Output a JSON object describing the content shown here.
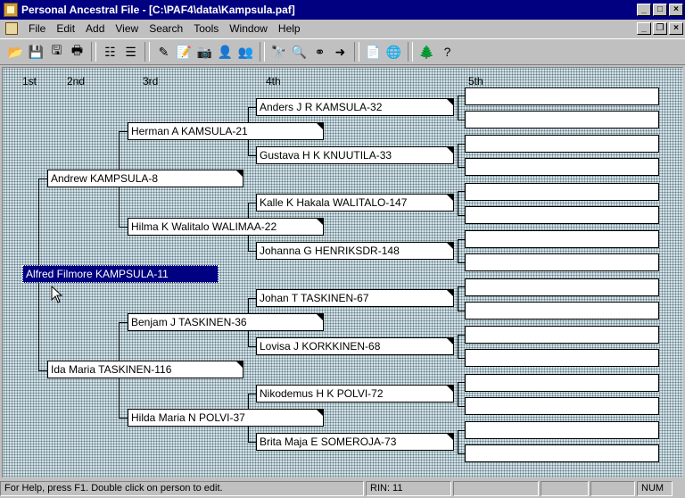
{
  "window": {
    "title": "Personal Ancestral File - [C:\\PAF4\\data\\Kampsula.paf]",
    "controls": [
      "minimize",
      "maximize",
      "close"
    ]
  },
  "menu": [
    {
      "label": "File"
    },
    {
      "label": "Edit"
    },
    {
      "label": "Add"
    },
    {
      "label": "View"
    },
    {
      "label": "Search"
    },
    {
      "label": "Tools"
    },
    {
      "label": "Window"
    },
    {
      "label": "Help"
    }
  ],
  "toolbar": {
    "icons": [
      "open-folder-icon",
      "save-icon",
      "save-as-icon",
      "print-icon",
      "family-view-icon",
      "pedigree-view-icon",
      "edit-individual-icon",
      "notes-icon",
      "multimedia-icon",
      "add-person-icon",
      "add-family-icon",
      "search-icon",
      "search-individual-icon",
      "relationship-icon",
      "navigate-icon",
      "reports-icon",
      "internet-icon",
      "tree-icon",
      "help-icon"
    ]
  },
  "pedigree": {
    "generations": [
      "1st",
      "2nd",
      "3rd",
      "4th",
      "5th"
    ],
    "gen1": {
      "name": "Alfred Filmore KAMPSULA-11",
      "selected": true
    },
    "gen2": [
      "Andrew KAMPSULA-8",
      "Ida Maria TASKINEN-116"
    ],
    "gen3": [
      "Herman A KAMSULA-21",
      "Hilma K Walitalo WALIMAA-22",
      "Benjam J TASKINEN-36",
      "Hilda Maria N POLVI-37"
    ],
    "gen4": [
      "Anders J R KAMSULA-32",
      "Gustava H K KNUUTILA-33",
      "Kalle K Hakala WALITALO-147",
      "Johanna G HENRIKSDR-148",
      "Johan T TASKINEN-67",
      "Lovisa J KORKKINEN-68",
      "Nikodemus H K POLVI-72",
      "Brita Maja E SOMEROJA-73"
    ],
    "gen5_empty_slots": 16
  },
  "statusbar": {
    "help": "For Help, press F1. Double click on person to edit.",
    "rin": "RIN: 11",
    "num": "NUM"
  }
}
